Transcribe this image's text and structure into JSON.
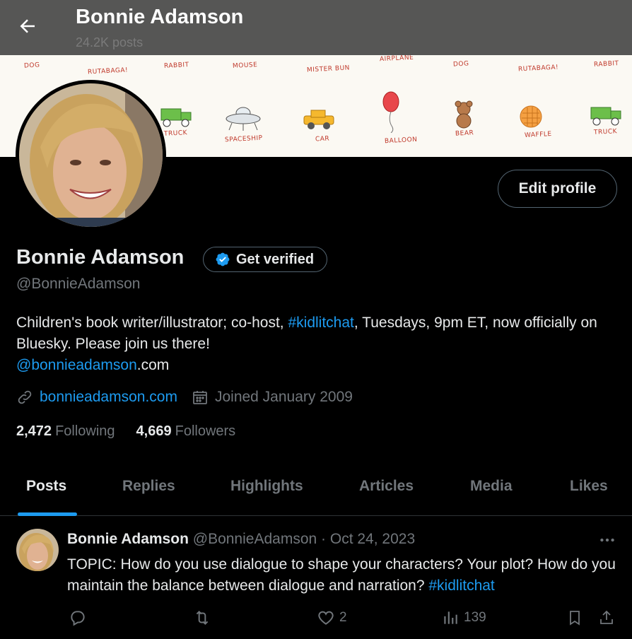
{
  "topbar": {
    "name": "Bonnie Adamson",
    "post_count": "24.2K posts"
  },
  "banner": {
    "doodles": [
      "DOG",
      "RUTABAGA!",
      "RABBIT",
      "MOUSE",
      "MISTER BUN",
      "AIRPLANE",
      "DOG",
      "RUTABAGA!",
      "RABBIT",
      "TRUCK",
      "SPACESHIP",
      "CAR",
      "BALLOON",
      "BEAR",
      "WAFFLE",
      "TRUCK"
    ]
  },
  "profile": {
    "edit_label": "Edit profile",
    "name": "Bonnie Adamson",
    "verify_label": "Get verified",
    "handle": "@BonnieAdamson",
    "bio": {
      "part1": "Children's book writer/illustrator; co-host, ",
      "hashtag": "#kidlitchat",
      "part2": ", Tuesdays, 9pm ET, now officially on Bluesky. Please join us there!",
      "mention": "@bonnieadamson",
      "suffix": ".com"
    },
    "website": "bonnieadamson.com",
    "joined": "Joined January 2009",
    "following_count": "2,472",
    "following_label": "Following",
    "followers_count": "4,669",
    "followers_label": "Followers"
  },
  "tabs": [
    "Posts",
    "Replies",
    "Highlights",
    "Articles",
    "Media",
    "Likes"
  ],
  "post": {
    "author": "Bonnie Adamson",
    "handle": "@BonnieAdamson",
    "separator": "·",
    "date": "Oct 24, 2023",
    "text": "TOPIC: How do you use dialogue to shape your characters? Your plot? How do you maintain the balance between dialogue and narration? ",
    "hashtag": "#kidlitchat",
    "likes": "2",
    "views": "139"
  },
  "colors": {
    "accent": "#1d9bf0",
    "muted": "#71767b",
    "text": "#e7e9ea",
    "border": "#2f3336",
    "background": "#000000"
  }
}
